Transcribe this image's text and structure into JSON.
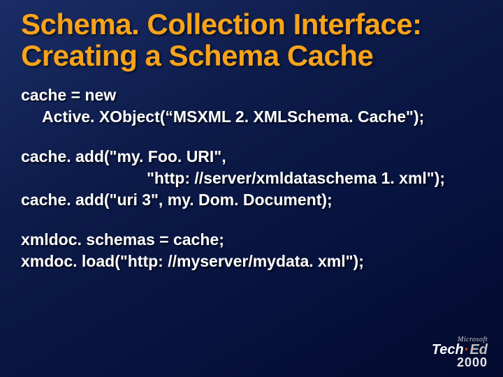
{
  "title": {
    "line1": "Schema. Collection Interface:",
    "line2": "Creating a Schema Cache"
  },
  "code": {
    "block1_l1": "cache =  new",
    "block1_l2": "Active. XObject(“MSXML 2. XMLSchema. Cache\");",
    "block2_l1": "cache. add(\"my. Foo. URI\",",
    "block2_l2": "\"http: //server/xmldataschema 1. xml\");",
    "block2_l3": "cache. add(\"uri 3\", my. Dom. Document);",
    "block3_l1": "xmldoc. schemas = cache;",
    "block3_l2": "xmdoc. load(\"http: //myserver/mydata. xml\");"
  },
  "logo": {
    "brand": "Microsoft",
    "tech": "Tech",
    "dot": "·",
    "ed": "Ed",
    "year": "2000"
  }
}
